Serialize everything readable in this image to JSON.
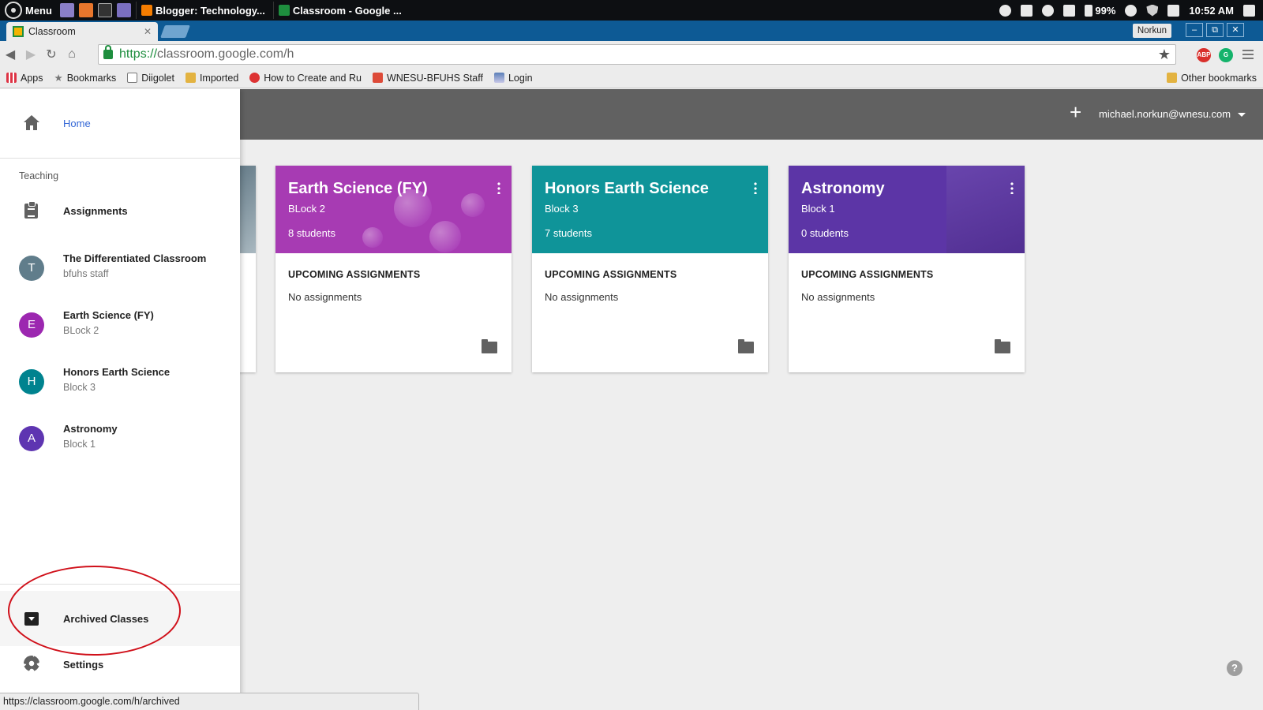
{
  "taskbar": {
    "menu_label": "Menu",
    "tasks": [
      {
        "label": "Blogger: Technology...",
        "favicon_color": "#f57d00"
      },
      {
        "label": "Classroom - Google ...",
        "favicon_color": "#1e8e3e"
      }
    ],
    "battery": "99%",
    "time": "10:52 AM"
  },
  "browser": {
    "tab_title": "Classroom",
    "profile_name": "Norkun",
    "window_controls": [
      "–",
      "⧉",
      "✕"
    ],
    "url_scheme": "https://",
    "url_rest": "classroom.google.com/h",
    "bookmarks": [
      {
        "label": "Apps",
        "icon": "apps-grid-icon"
      },
      {
        "label": "Bookmarks",
        "icon": "star-icon"
      },
      {
        "label": "Diigolet",
        "icon": "document-icon"
      },
      {
        "label": "Imported",
        "icon": "folder-icon"
      },
      {
        "label": "How to Create and Ru",
        "icon": "red-circle-icon"
      },
      {
        "label": "WNESU-BFUHS Staff",
        "icon": "google-plus-icon"
      },
      {
        "label": "Login",
        "icon": "image-icon"
      }
    ],
    "other_bookmarks": "Other bookmarks",
    "status_url": "https://classroom.google.com/h/archived"
  },
  "appbar": {
    "account": "michael.norkun@wnesu.com"
  },
  "drawer": {
    "home_label": "Home",
    "teaching_label": "Teaching",
    "assignments_label": "Assignments",
    "classes": [
      {
        "initial": "T",
        "name": "The Differentiated Classroom",
        "section": "bfuhs staff",
        "color": "#607d8b"
      },
      {
        "initial": "E",
        "name": "Earth Science (FY)",
        "section": "BLock 2",
        "color": "#9c27b0"
      },
      {
        "initial": "H",
        "name": "Honors Earth Science",
        "section": "Block 3",
        "color": "#00838f"
      },
      {
        "initial": "A",
        "name": "Astronomy",
        "section": "Block 1",
        "color": "#5e35b1"
      }
    ],
    "archived_label": "Archived Classes",
    "settings_label": "Settings"
  },
  "cards": [
    {
      "title": "Earth Science (FY)",
      "section": "BLock 2",
      "students": "8 students",
      "upcoming": "UPCOMING ASSIGNMENTS",
      "none": "No assignments",
      "color": "#a73bb3"
    },
    {
      "title": "Honors Earth Science",
      "section": "Block 3",
      "students": "7 students",
      "upcoming": "UPCOMING ASSIGNMENTS",
      "none": "No assignments",
      "color": "#0f9499"
    },
    {
      "title": "Astronomy",
      "section": "Block 1",
      "students": "0 students",
      "upcoming": "UPCOMING ASSIGNMENTS",
      "none": "No assignments",
      "color": "#5c35a6"
    }
  ],
  "help_label": "?"
}
